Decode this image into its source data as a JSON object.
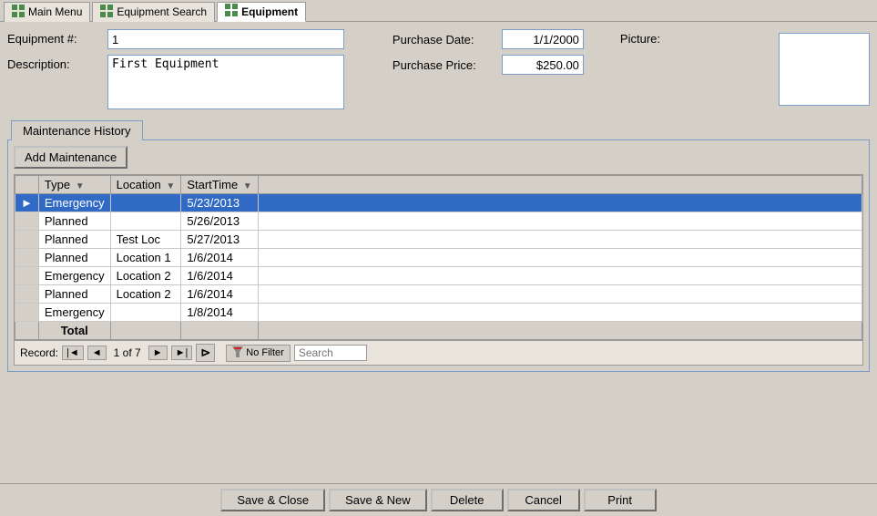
{
  "tabs": [
    {
      "id": "main-menu",
      "label": "Main Menu",
      "icon": "grid",
      "active": false
    },
    {
      "id": "equipment-search",
      "label": "Equipment Search",
      "icon": "grid",
      "active": false
    },
    {
      "id": "equipment",
      "label": "Equipment",
      "icon": "grid",
      "active": true
    }
  ],
  "form": {
    "equipment_number_label": "Equipment #:",
    "equipment_number_value": "1",
    "description_label": "Description:",
    "description_value": "First Equipment",
    "purchase_date_label": "Purchase Date:",
    "purchase_date_value": "1/1/2000",
    "purchase_price_label": "Purchase Price:",
    "purchase_price_value": "$250.00",
    "picture_label": "Picture:"
  },
  "maintenance": {
    "tab_label": "Maintenance History",
    "add_button_label": "Add Maintenance",
    "columns": [
      {
        "id": "type",
        "label": "Type"
      },
      {
        "id": "location",
        "label": "Location"
      },
      {
        "id": "starttime",
        "label": "StartTime"
      }
    ],
    "rows": [
      {
        "type": "Emergency",
        "location": "",
        "starttime": "5/23/2013",
        "selected": true
      },
      {
        "type": "Planned",
        "location": "",
        "starttime": "5/26/2013",
        "selected": false
      },
      {
        "type": "Planned",
        "location": "Test Loc",
        "starttime": "5/27/2013",
        "selected": false
      },
      {
        "type": "Planned",
        "location": "Location 1",
        "starttime": "1/6/2014",
        "selected": false
      },
      {
        "type": "Emergency",
        "location": "Location 2",
        "starttime": "1/6/2014",
        "selected": false
      },
      {
        "type": "Planned",
        "location": "Location 2",
        "starttime": "1/6/2014",
        "selected": false
      },
      {
        "type": "Emergency",
        "location": "",
        "starttime": "1/8/2014",
        "selected": false
      }
    ],
    "total_label": "Total"
  },
  "record_nav": {
    "record_label": "Record:",
    "current": "1 of 7",
    "no_filter_label": "No Filter",
    "search_placeholder": "Search"
  },
  "buttons": {
    "save_close": "Save & Close",
    "save_new": "Save & New",
    "delete": "Delete",
    "cancel": "Cancel",
    "print": "Print"
  }
}
